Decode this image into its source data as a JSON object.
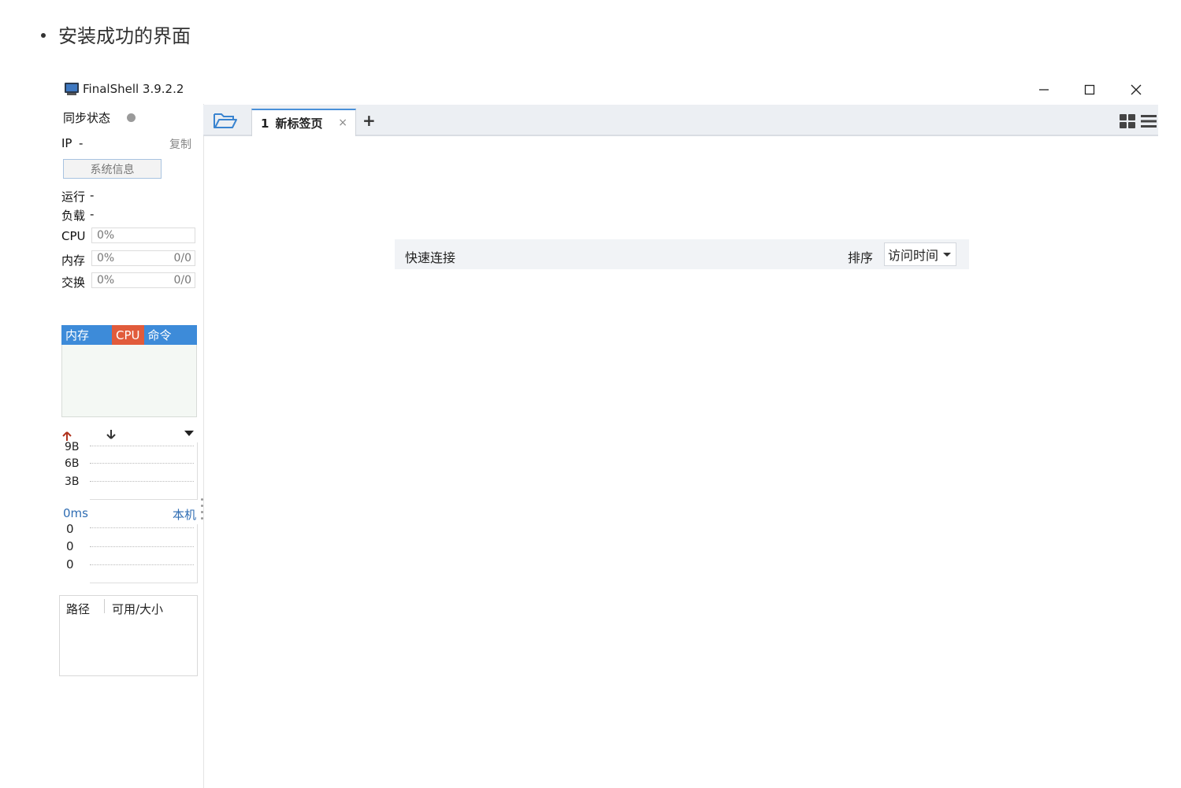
{
  "doc": {
    "bullet_text": "安装成功的界面"
  },
  "window": {
    "title": "FinalShell 3.9.2.2",
    "minimize_glyph": "—",
    "close_glyph": "✕"
  },
  "left_panel": {
    "sync_label": "同步状态",
    "ip_label": "IP",
    "ip_value": "-",
    "copy_label": "复制",
    "sysinfo_button": "系统信息",
    "uptime_label": "运行",
    "uptime_value": "-",
    "load_label": "负载",
    "load_value": "-",
    "cpu": {
      "label": "CPU",
      "percent_text": "0%",
      "percent": 0
    },
    "memory": {
      "label": "内存",
      "percent_text": "0%",
      "usage": "0/0",
      "percent": 0
    },
    "swap": {
      "label": "交换",
      "percent_text": "0%",
      "usage": "0/0",
      "percent": 0
    },
    "process_tabs": [
      "内存",
      "CPU",
      "命令"
    ],
    "network": {
      "y_ticks": [
        "9B",
        "6B",
        "3B"
      ]
    },
    "ping": {
      "latency": "0ms",
      "target": "本机",
      "y_ticks": [
        "0",
        "0",
        "0"
      ]
    },
    "disk": {
      "col_path": "路径",
      "col_size": "可用/大小"
    }
  },
  "tabs": {
    "active_tab": {
      "index": "1",
      "label": "新标签页",
      "close_glyph": "×"
    },
    "add_glyph": "+"
  },
  "quick_connect": {
    "title": "快速连接",
    "sort_label": "排序",
    "sort_value": "访问时间"
  },
  "colors": {
    "tab_accent": "#4a90d9",
    "process_tab_bg": "#3d8bd9",
    "process_tab_cpu": "#e15b3b",
    "link_blue": "#2f6db3"
  }
}
